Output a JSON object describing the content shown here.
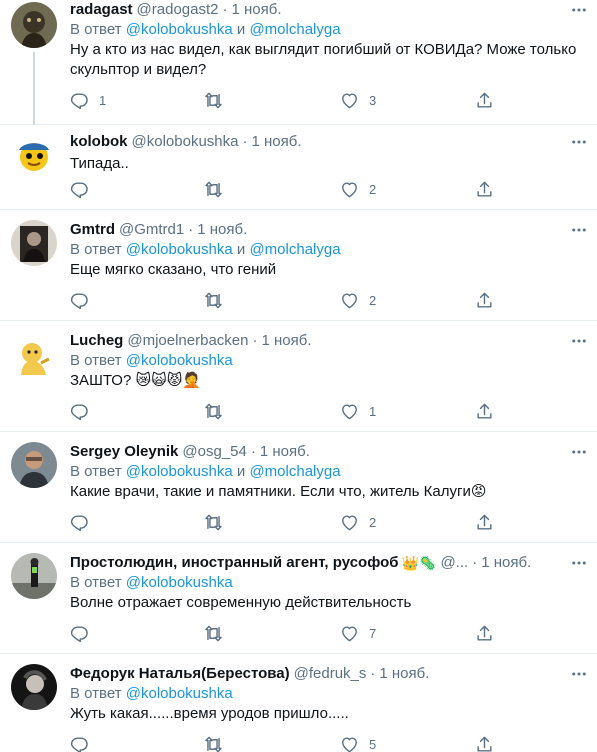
{
  "labels": {
    "in_reply_to": "В ответ",
    "and": "и"
  },
  "tweets": [
    {
      "name": "radagast",
      "handle": "@radogast2",
      "time": "1 нояб.",
      "mentions": [
        "@kolobokushka",
        "@molchalyga"
      ],
      "text": "Ну а кто из нас видел, как выглядит погибший от КОВИДа? Може только скульптор и видел?",
      "replies": "1",
      "retweets": "",
      "likes": "3"
    },
    {
      "name": "kolobok",
      "handle": "@kolobokushka",
      "time": "1 нояб.",
      "text": "Типада..",
      "replies": "",
      "retweets": "",
      "likes": "2"
    },
    {
      "name": "Gmtrd",
      "handle": "@Gmtrd1",
      "time": "1 нояб.",
      "mentions": [
        "@kolobokushka",
        "@molchalyga"
      ],
      "text": "Еще мягко сказано, что гений",
      "replies": "",
      "retweets": "",
      "likes": "2"
    },
    {
      "name": "Lucheg",
      "handle": "@mjoelnerbacken",
      "time": "1 нояб.",
      "mentions": [
        "@kolobokushka"
      ],
      "text": "ЗАШТО? 😿🙀😾🤦",
      "replies": "",
      "retweets": "",
      "likes": "1"
    },
    {
      "name": "Sergey Oleynik",
      "handle": "@osg_54",
      "time": "1 нояб.",
      "mentions": [
        "@kolobokushka",
        "@molchalyga"
      ],
      "text": "Какие врачи, такие и памятники. Если что, житель Калуги😡",
      "replies": "",
      "retweets": "",
      "likes": "2"
    },
    {
      "name": "Простолюдин, иностранный агент, русофоб",
      "name_emoji": "👑🦠",
      "handle": "@...",
      "time": "1 нояб.",
      "mentions": [
        "@kolobokushka"
      ],
      "text": "Волне отражает современную действительность",
      "replies": "",
      "retweets": "",
      "likes": "7"
    },
    {
      "name": "Федорук Наталья(Берестова)",
      "handle": "@fedruk_s",
      "time": "1 нояб.",
      "mentions": [
        "@kolobokushka"
      ],
      "text": "Жуть какая......время уродов пришло.....",
      "replies": "",
      "retweets": "",
      "likes": "5"
    }
  ],
  "icons": {
    "more": "more-horizontal-icon",
    "reply": "reply-bubble-icon",
    "retweet": "retweet-icon",
    "like": "heart-icon",
    "share": "share-icon"
  },
  "colors": {
    "text": "#0f1419",
    "secondary": "#5b7083",
    "link": "#1b95e0",
    "divider": "#e6ecf0"
  }
}
